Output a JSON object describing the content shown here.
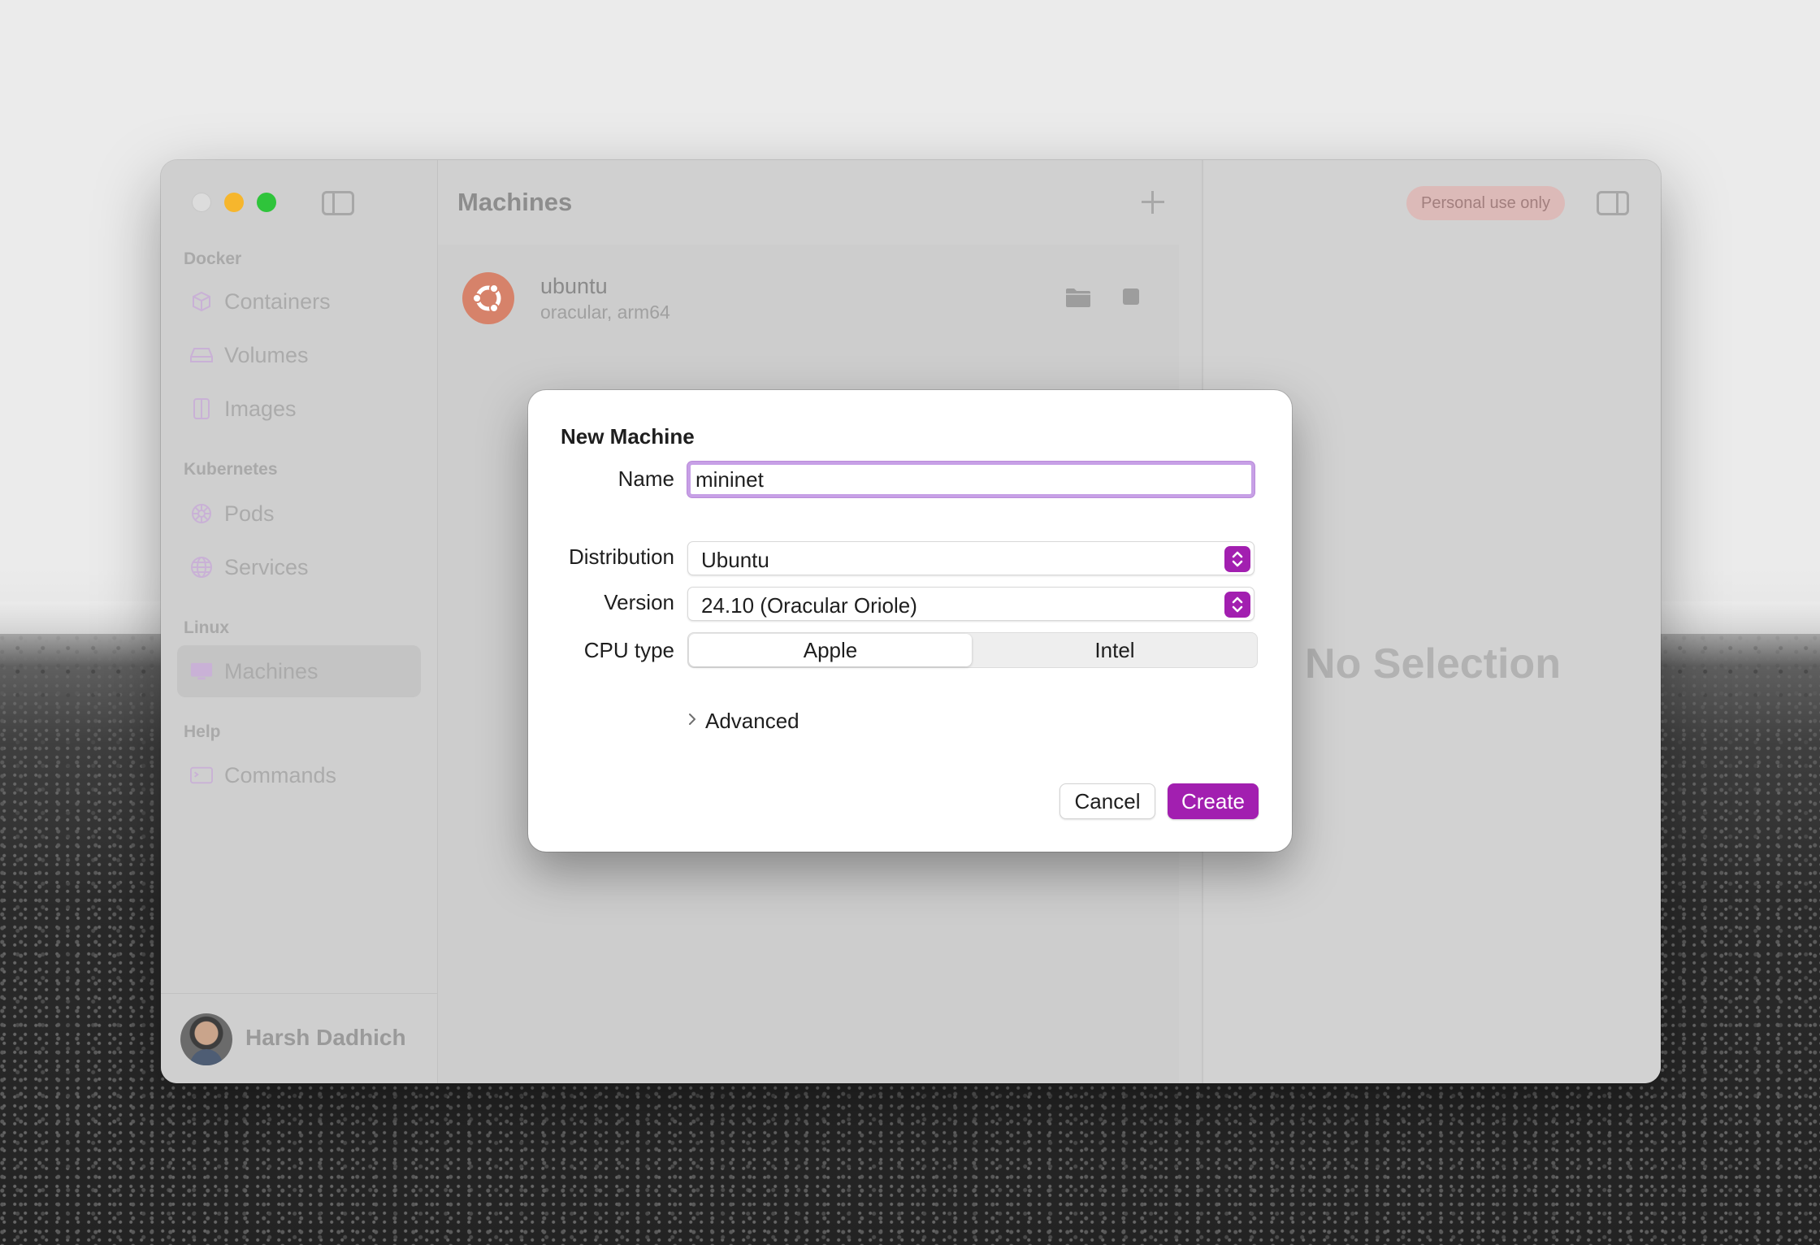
{
  "window": {
    "sidebar": {
      "sections": [
        {
          "label": "Docker",
          "items": [
            {
              "label": "Containers",
              "icon": "cube-icon"
            },
            {
              "label": "Volumes",
              "icon": "drive-icon"
            },
            {
              "label": "Images",
              "icon": "images-icon"
            }
          ]
        },
        {
          "label": "Kubernetes",
          "items": [
            {
              "label": "Pods",
              "icon": "helm-icon"
            },
            {
              "label": "Services",
              "icon": "globe-icon"
            }
          ]
        },
        {
          "label": "Linux",
          "items": [
            {
              "label": "Machines",
              "icon": "monitor-icon",
              "active": true
            }
          ]
        },
        {
          "label": "Help",
          "items": [
            {
              "label": "Commands",
              "icon": "terminal-icon"
            }
          ]
        }
      ],
      "user": {
        "name": "Harsh Dadhich"
      }
    },
    "list": {
      "title": "Machines",
      "machines": [
        {
          "name": "ubuntu",
          "detail": "oracular, arm64"
        }
      ]
    },
    "detail": {
      "badge": "Personal use only",
      "empty_text": "No Selection"
    }
  },
  "dialog": {
    "title": "New Machine",
    "name_label": "Name",
    "name_value": "mininet",
    "distribution_label": "Distribution",
    "distribution_value": "Ubuntu",
    "version_label": "Version",
    "version_value": "24.10 (Oracular Oriole)",
    "cpu_label": "CPU type",
    "cpu_options": [
      "Apple",
      "Intel"
    ],
    "cpu_selected": "Apple",
    "advanced_label": "Advanced",
    "cancel_label": "Cancel",
    "create_label": "Create"
  },
  "colors": {
    "accent": "#a21fb0",
    "focus_ring": "#c7a0e6",
    "badge_bg": "#dcbab8",
    "ubuntu_logo": "#d6826a"
  }
}
